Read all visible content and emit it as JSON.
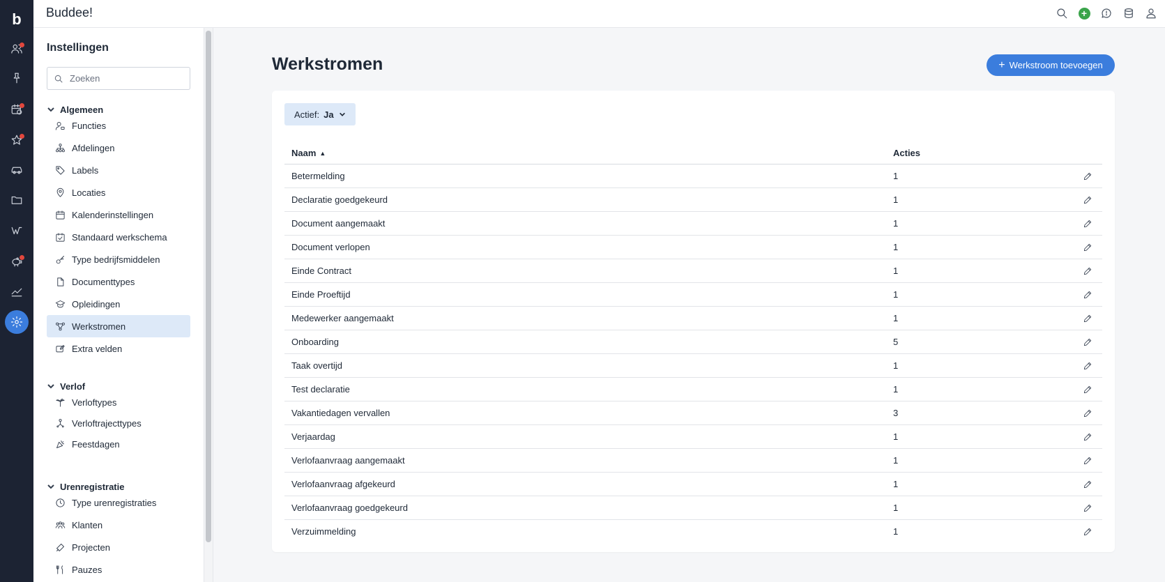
{
  "app": {
    "logo": "b",
    "brand": "Buddee!"
  },
  "rail": {
    "items": [
      {
        "icon": "users-icon",
        "badge": true
      },
      {
        "icon": "pin-icon",
        "badge": false
      },
      {
        "icon": "calendar-clock-icon",
        "badge": true
      },
      {
        "icon": "star-icon",
        "badge": true
      },
      {
        "icon": "car-icon",
        "badge": false
      },
      {
        "icon": "folder-icon",
        "badge": false
      },
      {
        "icon": "wiki-icon",
        "badge": false
      },
      {
        "icon": "piggy-bank-icon",
        "badge": true
      },
      {
        "icon": "chart-icon",
        "badge": false
      },
      {
        "icon": "gear-icon",
        "badge": false,
        "active": true
      }
    ]
  },
  "topbar": {
    "icons": [
      "search-icon",
      "add-icon",
      "chat-icon",
      "database-icon",
      "user-icon"
    ]
  },
  "settings": {
    "title": "Instellingen",
    "search_placeholder": "Zoeken",
    "sections": [
      {
        "label": "Algemeen",
        "items": [
          {
            "label": "Functies",
            "icon": "person-badge-icon"
          },
          {
            "label": "Afdelingen",
            "icon": "org-chart-icon"
          },
          {
            "label": "Labels",
            "icon": "tag-icon"
          },
          {
            "label": "Locaties",
            "icon": "map-pin-icon"
          },
          {
            "label": "Kalenderinstellingen",
            "icon": "calendar-icon"
          },
          {
            "label": "Standaard werkschema",
            "icon": "calendar-check-icon"
          },
          {
            "label": "Type bedrijfsmiddelen",
            "icon": "key-icon"
          },
          {
            "label": "Documenttypes",
            "icon": "document-icon"
          },
          {
            "label": "Opleidingen",
            "icon": "graduation-cap-icon"
          },
          {
            "label": "Werkstromen",
            "icon": "workflow-icon",
            "active": true
          },
          {
            "label": "Extra velden",
            "icon": "edit-field-icon"
          }
        ]
      },
      {
        "label": "Verlof",
        "items": [
          {
            "label": "Verloftypes",
            "icon": "palm-tree-icon"
          },
          {
            "label": "Verloftrajecttypes",
            "icon": "person-route-icon"
          },
          {
            "label": "Feestdagen",
            "icon": "party-icon"
          }
        ]
      },
      {
        "label": "Urenregistratie",
        "items": [
          {
            "label": "Type urenregistraties",
            "icon": "clock-icon"
          },
          {
            "label": "Klanten",
            "icon": "group-icon"
          },
          {
            "label": "Projecten",
            "icon": "tools-icon"
          },
          {
            "label": "Pauzes",
            "icon": "cutlery-icon"
          }
        ]
      }
    ]
  },
  "main": {
    "title": "Werkstromen",
    "add_button": "Werkstroom toevoegen",
    "filter": {
      "label": "Actief:",
      "value": "Ja"
    },
    "table": {
      "columns": [
        "Naam",
        "Acties"
      ],
      "rows": [
        {
          "name": "Betermelding",
          "actions": "1"
        },
        {
          "name": "Declaratie goedgekeurd",
          "actions": "1"
        },
        {
          "name": "Document aangemaakt",
          "actions": "1"
        },
        {
          "name": "Document verlopen",
          "actions": "1"
        },
        {
          "name": "Einde Contract",
          "actions": "1"
        },
        {
          "name": "Einde Proeftijd",
          "actions": "1"
        },
        {
          "name": "Medewerker aangemaakt",
          "actions": "1"
        },
        {
          "name": "Onboarding",
          "actions": "5"
        },
        {
          "name": "Taak overtijd",
          "actions": "1"
        },
        {
          "name": "Test declaratie",
          "actions": "1"
        },
        {
          "name": "Vakantiedagen vervallen",
          "actions": "3"
        },
        {
          "name": "Verjaardag",
          "actions": "1"
        },
        {
          "name": "Verlofaanvraag aangemaakt",
          "actions": "1"
        },
        {
          "name": "Verlofaanvraag afgekeurd",
          "actions": "1"
        },
        {
          "name": "Verlofaanvraag goedgekeurd",
          "actions": "1"
        },
        {
          "name": "Verzuimmelding",
          "actions": "1"
        }
      ]
    }
  },
  "colors": {
    "accent": "#3b7ddd",
    "rail_bg": "#1c2333",
    "badge": "#e2473d",
    "active_bg": "#dde9f8"
  }
}
